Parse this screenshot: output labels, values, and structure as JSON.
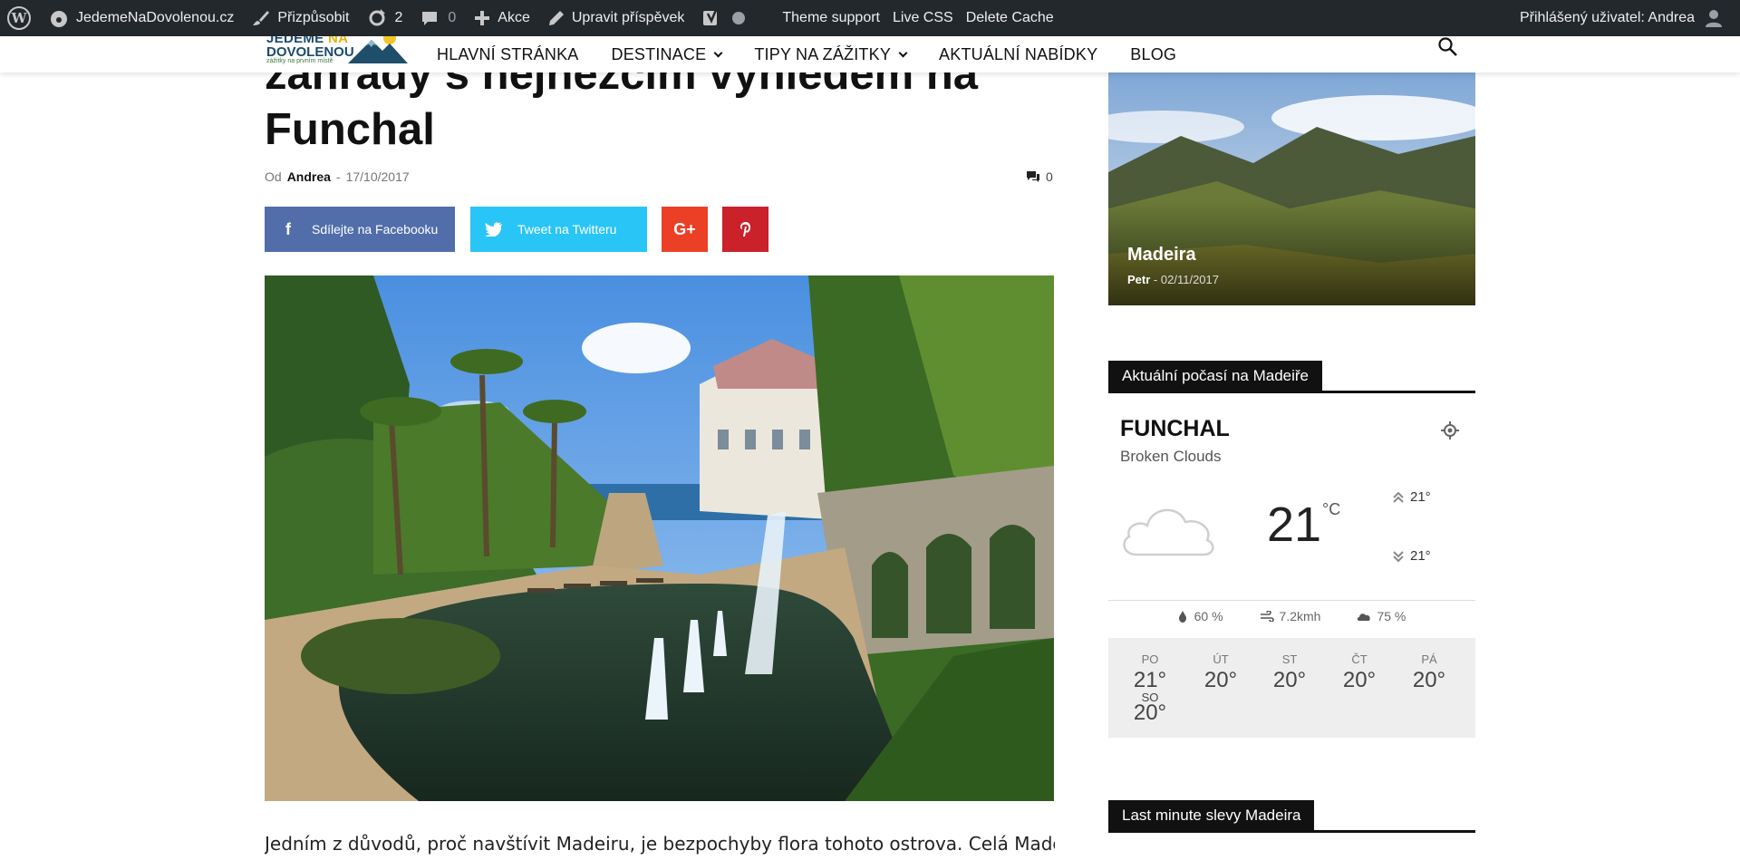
{
  "adminbar": {
    "site_name": "JedemeNaDovolenou.cz",
    "customize": "Přizpůsobit",
    "updates_count": "2",
    "comments_count": "0",
    "new_label": "Akce",
    "edit_post": "Upravit příspěvek",
    "theme_support": "Theme support",
    "live_css": "Live CSS",
    "delete_cache": "Delete Cache",
    "user_greeting": "Přihlášený uživatel: Andrea"
  },
  "logo": {
    "line1a": "JEDEME",
    "line1b": "NA",
    "line2": "DOVOLENOU",
    "tagline": "zážitky na prvním místě"
  },
  "nav": {
    "items": [
      {
        "label": "HLAVNÍ STRÁNKA"
      },
      {
        "label": "DESTINACE"
      },
      {
        "label": "TIPY NA ZÁŽITKY"
      },
      {
        "label": "AKTUÁLNÍ NABÍDKY"
      },
      {
        "label": "BLOG"
      }
    ]
  },
  "article": {
    "title_line1": "zahrady s nejhezčím výhledem na",
    "title_line2": "Funchal",
    "by_label": "Od",
    "author": "Andrea",
    "separator": "-",
    "date": "17/10/2017",
    "comment_count": "0",
    "share_facebook": "Sdílejte na Facebooku",
    "share_twitter": "Tweet na Twitteru",
    "body_start": "Jedním z důvodů, proč navštívit Madeiru, je bezpochyby flora tohoto ostrova. Celá Madeira"
  },
  "sidebar": {
    "featured": {
      "title": "Madeira",
      "author": "Petr",
      "separator": "-",
      "date": "02/11/2017"
    },
    "weather_title": "Aktuální počasí na Madeiře",
    "weather": {
      "city": "FUNCHAL",
      "description": "Broken Clouds",
      "temp": "21",
      "unit": "°C",
      "high": "21°",
      "low": "21°",
      "humidity": "60 %",
      "wind": "7.2kmh",
      "clouds": "75 %",
      "forecast": [
        {
          "day": "PO",
          "temp": "21°"
        },
        {
          "day": "ÚT",
          "temp": "20°"
        },
        {
          "day": "ST",
          "temp": "20°"
        },
        {
          "day": "ČT",
          "temp": "20°"
        },
        {
          "day": "PÁ",
          "temp": "20°"
        },
        {
          "day": "SO",
          "temp": "20°"
        }
      ]
    },
    "lastminute_title": "Last minute slevy Madeira"
  },
  "colors": {
    "facebook": "#516eab",
    "twitter": "#29c5f6",
    "googleplus": "#eb4026",
    "pinterest": "#ca212a",
    "adminbar": "#23282d"
  }
}
